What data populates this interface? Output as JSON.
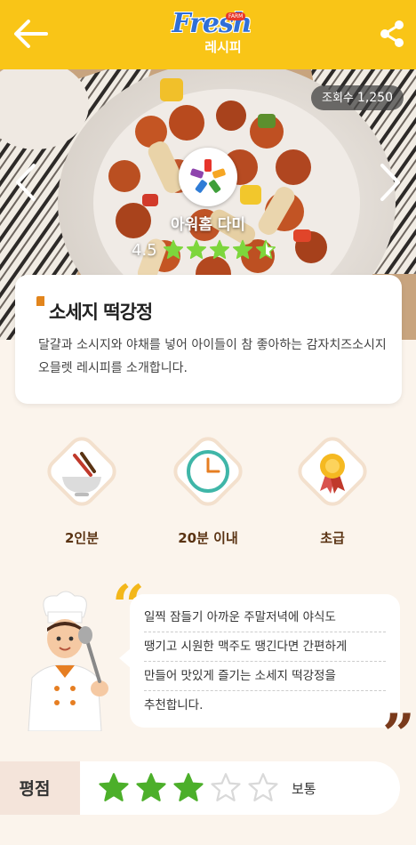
{
  "header": {
    "brand": "Fresh",
    "brand_badge": "FARM",
    "brand_sub": "레시피",
    "back_icon": "back-arrow-icon",
    "share_icon": "share-icon",
    "color": "#f9c517"
  },
  "hero": {
    "view_label": "조회수",
    "view_count": "1,250",
    "author_name": "아워홈 다미",
    "author_rating": "4.5",
    "author_stars": 4.5
  },
  "recipe": {
    "title": "소세지 떡강정",
    "description": "달걀과 소시지와 야채를 넣어 아이들이 참 좋아하는 감자치즈소시지 오믈렛 레시피를 소개합니다."
  },
  "info": {
    "servings": "2인분",
    "time": "20분 이내",
    "difficulty": "초급"
  },
  "speech": {
    "lines": [
      "일찍 잠들기 아까운 주말저녁에 야식도",
      "땡기고 시원한 맥주도 땡긴다면 간편하게",
      "만들어 맛있게 즐기는 소세지 떡강정을",
      "추천합니다."
    ]
  },
  "rating": {
    "label": "평점",
    "value": 3,
    "max": 5,
    "text": "보통",
    "filled_color": "#4caf2a",
    "empty_color": "#d9d9d9"
  }
}
